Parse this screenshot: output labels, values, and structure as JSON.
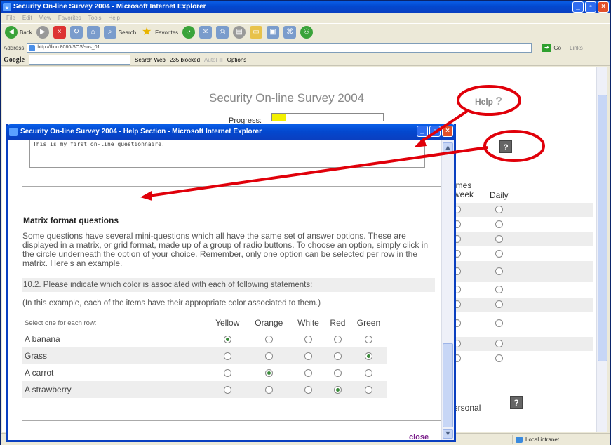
{
  "browser": {
    "window_title": "Security On-line Survey 2004 - Microsoft Internet Explorer",
    "menu": [
      "File",
      "Edit",
      "View",
      "Favorites",
      "Tools",
      "Help"
    ],
    "toolbar": {
      "back": "Back",
      "search": "Search",
      "favorites": "Favorites"
    },
    "address_label": "Address",
    "address_value": "http://flinn:8080/SOS/sos_01",
    "go_label": "Go",
    "links_label": "Links",
    "google": {
      "logo": "Google",
      "search_web": "Search Web",
      "blocked": "235 blocked",
      "autofill": "AutoFill",
      "options": "Options"
    },
    "status_zone": "Local intranet"
  },
  "page": {
    "title": "Security On-line Survey 2004",
    "help_label": "Help",
    "help_icon": "?",
    "progress_label": "Progress:",
    "progress_fraction": 0.12,
    "bg_matrix_header_line1": "imes",
    "bg_matrix_header_line2": "week",
    "bg_matrix_daily": "Daily",
    "bg_personal": "ersonal",
    "qicon": "?"
  },
  "popup": {
    "title": "Security On-line Survey 2004 - Help Section - Microsoft Internet Explorer",
    "textarea_text": "This is my first on-line questionnaire.",
    "heading": "Matrix format questions",
    "intro": "Some questions have several mini-questions which all have the same set of answer options. These are displayed in a matrix, or grid format, made up of a group of radio buttons. To choose an option, simply click in the circle underneath the option of your choice. Remember, only one option can be selected per row in the matrix. Here's an example.",
    "question": "10.2. Please indicate which color is associated with each of following statements:",
    "note": "(In this example, each of the items have their appropriate color associated to them.)",
    "table": {
      "header": "Select one for each row:",
      "options": [
        "Yellow",
        "Orange",
        "White",
        "Red",
        "Green"
      ],
      "rows": [
        {
          "label": "A banana",
          "selected": 0
        },
        {
          "label": "Grass",
          "selected": 4
        },
        {
          "label": "A carrot",
          "selected": 1
        },
        {
          "label": "A strawberry",
          "selected": 3
        }
      ]
    },
    "close_label": "close"
  },
  "colors": {
    "annotation": "#e0000a",
    "progress": "#f3f000",
    "xp_title": "#0348cf"
  }
}
